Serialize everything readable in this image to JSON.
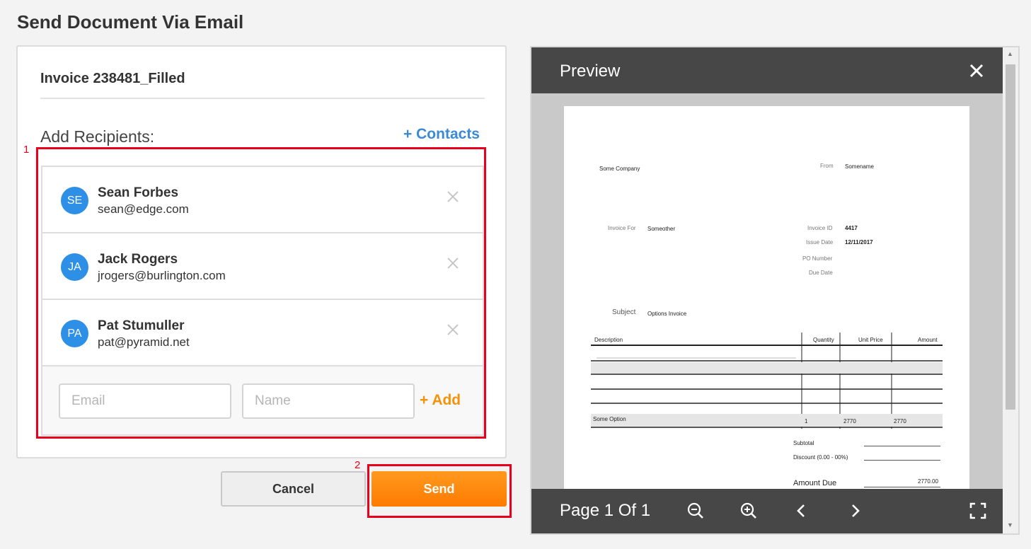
{
  "page_title": "Send Document Via Email",
  "document_name": "Invoice 238481_Filled",
  "add_recipients_label": "Add Recipients:",
  "contacts_link": "+ Contacts",
  "recipients": [
    {
      "initials": "SE",
      "name": "Sean Forbes",
      "email": "sean@edge.com"
    },
    {
      "initials": "JA",
      "name": "Jack Rogers",
      "email": "jrogers@burlington.com"
    },
    {
      "initials": "PA",
      "name": "Pat Stumuller",
      "email": "pat@pyramid.net"
    }
  ],
  "new_recipient": {
    "email_placeholder": "Email",
    "name_placeholder": "Name",
    "add_label": "+ Add"
  },
  "buttons": {
    "cancel": "Cancel",
    "send": "Send"
  },
  "annotations": {
    "box1": "1",
    "box2": "2"
  },
  "preview": {
    "title": "Preview",
    "page_indicator": "Page 1 Of 1",
    "invoice": {
      "company": "Some Company",
      "from_label": "From",
      "from_value": "Somename",
      "invoice_for_label": "Invoice For",
      "invoice_for_value": "Someother",
      "invoice_id_label": "Invoice ID",
      "invoice_id_value": "4417",
      "issue_date_label": "Issue Date",
      "issue_date_value": "12/11/2017",
      "po_label": "PO Number",
      "due_label": "Due Date",
      "subject_label": "Subject",
      "subject_value": "Options Invoice",
      "columns": [
        "Description",
        "Quantity",
        "Unit Price",
        "Amount"
      ],
      "row": {
        "description": "Some Option",
        "quantity": "1",
        "unit_price": "2770",
        "amount": "2770"
      },
      "subtotal_label": "Subtotal",
      "discount_label": "Discount (0.00 - 00%)",
      "amount_due_label": "Amount Due",
      "amount_due_value": "2770.00"
    }
  },
  "colors": {
    "accent_orange": "#ff8a0f",
    "link_blue": "#3a8ad6",
    "avatar_blue": "#2d8fe6",
    "highlight_red": "#e8001c",
    "preview_bar": "#474747"
  }
}
